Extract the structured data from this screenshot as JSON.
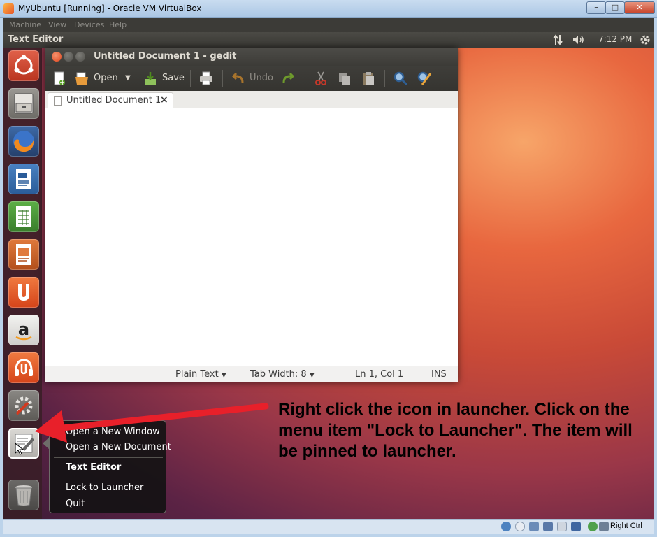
{
  "vbox": {
    "title": "MyUbuntu [Running] - Oracle VM VirtualBox",
    "menus": [
      "Machine",
      "View",
      "Devices",
      "Help"
    ],
    "host_key_label": "Right Ctrl"
  },
  "panel": {
    "app_title": "Text Editor",
    "clock": "7:12 PM"
  },
  "launcher": {
    "items": [
      "dash-home-icon",
      "files-icon",
      "firefox-icon",
      "writer-icon",
      "calc-icon",
      "impress-icon",
      "ubuntu-one-icon",
      "amazon-icon",
      "ubuntu-one-music-icon",
      "system-settings-icon",
      "text-editor-icon",
      "trash-icon"
    ]
  },
  "gedit": {
    "window_title": "Untitled Document 1 - gedit",
    "toolbar": {
      "open_label": "Open",
      "save_label": "Save",
      "undo_label": "Undo"
    },
    "tab_label": "Untitled Document 1",
    "tab_close": "×",
    "status": {
      "language": "Plain Text",
      "tab_width": "Tab Width:  8",
      "position": "Ln 1, Col 1",
      "mode": "INS"
    }
  },
  "context_menu": {
    "items": [
      "Open a New Window",
      "Open a New Document",
      "Text Editor",
      "Lock to Launcher",
      "Quit"
    ]
  },
  "annotation": {
    "text": "Right click the icon in launcher. Click on the menu item \"Lock to Launcher\". The item will be pinned to launcher."
  },
  "colors": {
    "ubuntu_orange": "#dd4814",
    "arrow_red": "#e8202a",
    "panel_dark": "#3c3b37"
  }
}
